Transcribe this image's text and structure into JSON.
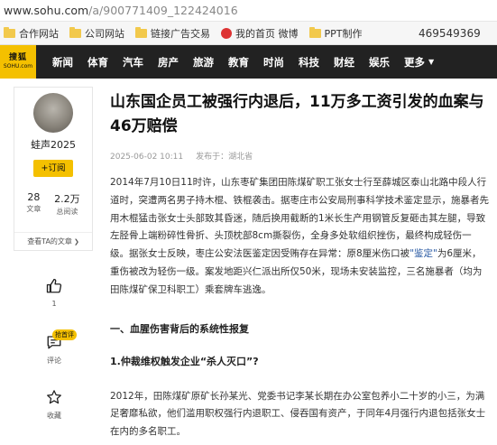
{
  "browser": {
    "url_host": "www.sohu.com",
    "url_path": "/a/900771409_122424016",
    "bookmarks": [
      "合作网站",
      "公司网站",
      "链接广告交易",
      "我的首页 微博",
      "PPT制作"
    ],
    "qq_number": "469549369"
  },
  "logo": {
    "line1": "搜狐",
    "line2": "SOHU.com"
  },
  "nav": {
    "items": [
      "新闻",
      "体育",
      "汽车",
      "房产",
      "旅游",
      "教育",
      "时尚",
      "科技",
      "财经",
      "娱乐"
    ],
    "more": "更多"
  },
  "author": {
    "name": "蛙声2025",
    "follow_label": "+订阅",
    "articles_count": "28",
    "articles_label": "文章",
    "reads_count": "2.2万",
    "reads_label": "总阅读",
    "see_ta_label": "查看TA的文章"
  },
  "actions": {
    "like_count": "1",
    "comment_badge": "抢首评",
    "comment_label": "评论",
    "collect_label": "收藏"
  },
  "article": {
    "title": "山东国企员工被强行内退后，11万多工资引发的血案与46万赔偿",
    "date": "2025-06-02 10:11",
    "source": "发布于：湖北省",
    "p1_before": "2014年7月10日11时许，山东枣矿集团田陈煤矿职工张女士行至薛城区泰山北路中段人行道时，突遭两名男子持木棍、铁棍袭击。据枣庄市公安局刑事科学技术鉴定显示，施暴者先用木棍猛击张女士头部致其昏迷，随后换用截断的1米长生产用钢管反复砸击其左腿，导致左胫骨上端粉碎性骨折、头顶枕部8cm撕裂伤，全身多处软组织挫伤，最终构成轻伤一级。据张女士反映，枣庄公安法医鉴定因受贿存在异常：原8厘米伤口被",
    "p1_link": "\"鉴定\"",
    "p1_after": "为6厘米，重伤被改为轻伤一级。案发地距兴仁派出所仅50米，现场未安装监控，三名施暴者（均为田陈煤矿保卫科职工）乘套牌车逃逸。",
    "section1": "一、血腥伤害背后的系统性报复",
    "sub1": "1.仲裁维权触发企业“杀人灭口”?",
    "p2": "2012年，田陈煤矿原矿长孙某光、党委书记李某长期在办公室包养小二十岁的小三，为满足奢靡私欲，他们滥用职权强行内退职工、侵吞国有资产，于同年4月强行内退包括张女士在内的多名职工。"
  }
}
